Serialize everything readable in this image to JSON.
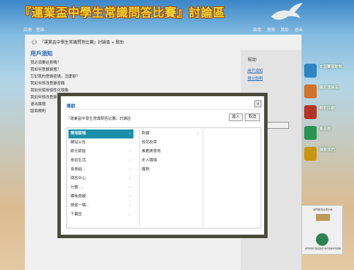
{
  "header": {
    "title": "『運業盃中學生常識問答比賽』討論區",
    "left_links": [
      "註冊",
      "登錄"
    ],
    "right_links": [
      "論壇",
      "搜索",
      "幫助",
      "退出"
    ]
  },
  "breadcrumb": "『運業盃中學生常識問答比賽』討論區 » 幫助",
  "faq": {
    "title": "用戶須知",
    "items": [
      "我必須要註冊嗎？",
      "我如何登錄論壇？",
      "忘記我的登錄密碼，怎麼辦？",
      "我如何修改登錄密碼",
      "我如何使用個性化頭像",
      "我如何修改登錄密碼",
      "退出論壇",
      "版面規則"
    ]
  },
  "help_panel": {
    "title": "幫助",
    "links": [
      "用戶須知",
      "積分說明"
    ]
  },
  "side_nav": [
    {
      "label": "本屆賽事動態",
      "color": "#2f8fd0"
    },
    {
      "label": "關於運業盃",
      "color": "#e07a2b"
    },
    {
      "label": "精彩回顧",
      "color": "#c0392b"
    },
    {
      "label": "青英榜",
      "color": "#2e9d5a"
    },
    {
      "label": "聯繫我們",
      "color": "#d4a017"
    }
  ],
  "badge": {
    "top": "澳門教育及青年局",
    "text": "澳門特別行政區政府 教育暨青年局贊助"
  },
  "modal": {
    "title": "導航",
    "close": "×",
    "path": "『運業盃中學生常識問答比賽』討論區",
    "enter": "進入",
    "cancel": "取消",
    "col1": [
      "常用版塊",
      "網站公告",
      "師兄師姐",
      "參加生活",
      "會員組...",
      "問答中心",
      "分層 ...",
      "課後挑戰",
      "旅遊一隅...",
      "下載區"
    ],
    "col2": [
      "刺繡",
      "校花校草",
      "推薦美食地",
      "步入職場",
      "寵物"
    ],
    "arrow": "›"
  }
}
